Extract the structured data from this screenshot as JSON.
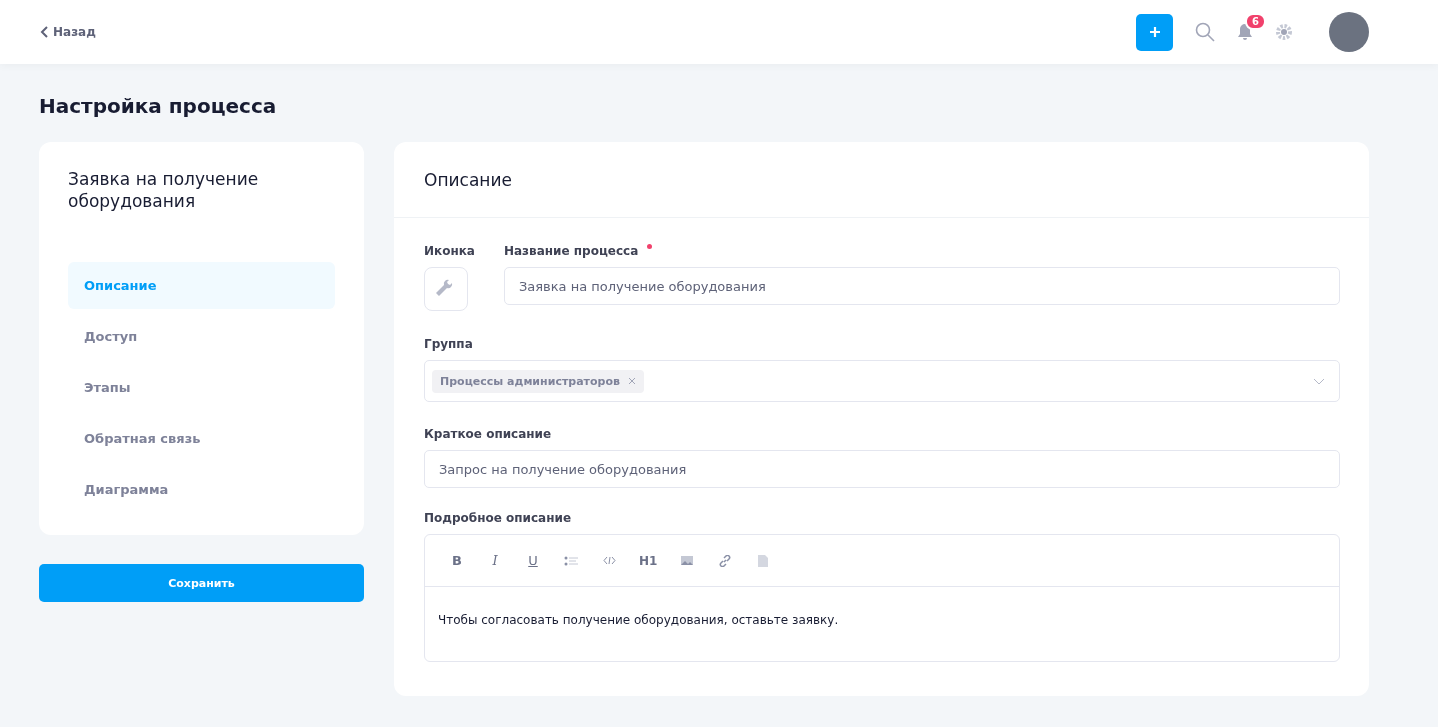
{
  "header": {
    "back": "Назад",
    "notifications_count": "6"
  },
  "page_title": "Настройка процесса",
  "sidebar": {
    "title": "Заявка на получение оборудования",
    "items": [
      {
        "label": "Описание",
        "selected": true
      },
      {
        "label": "Доступ",
        "selected": false
      },
      {
        "label": "Этапы",
        "selected": false
      },
      {
        "label": "Обратная связь",
        "selected": false
      },
      {
        "label": "Диаграмма",
        "selected": false
      }
    ],
    "save_button": "Сохранить"
  },
  "panel": {
    "title": "Описание",
    "icon_label": "Иконка",
    "name_label": "Название процесса",
    "name_required": true,
    "name_value": "Заявка на получение оборудования",
    "group_label": "Группа",
    "group_tags": [
      "Процессы администраторов"
    ],
    "short_label": "Краткое описание",
    "short_value": "Запрос на получение оборудования",
    "long_label": "Подробное описание",
    "toolbar": [
      {
        "kind": "bold",
        "text": "B"
      },
      {
        "kind": "italic",
        "text": "I"
      },
      {
        "kind": "underline",
        "text": "U"
      },
      {
        "kind": "list"
      },
      {
        "kind": "code"
      },
      {
        "kind": "heading",
        "text": "H1"
      },
      {
        "kind": "image"
      },
      {
        "kind": "link"
      },
      {
        "kind": "file"
      }
    ],
    "long_value": "Чтобы согласовать получение оборудования, оставьте заявку."
  }
}
